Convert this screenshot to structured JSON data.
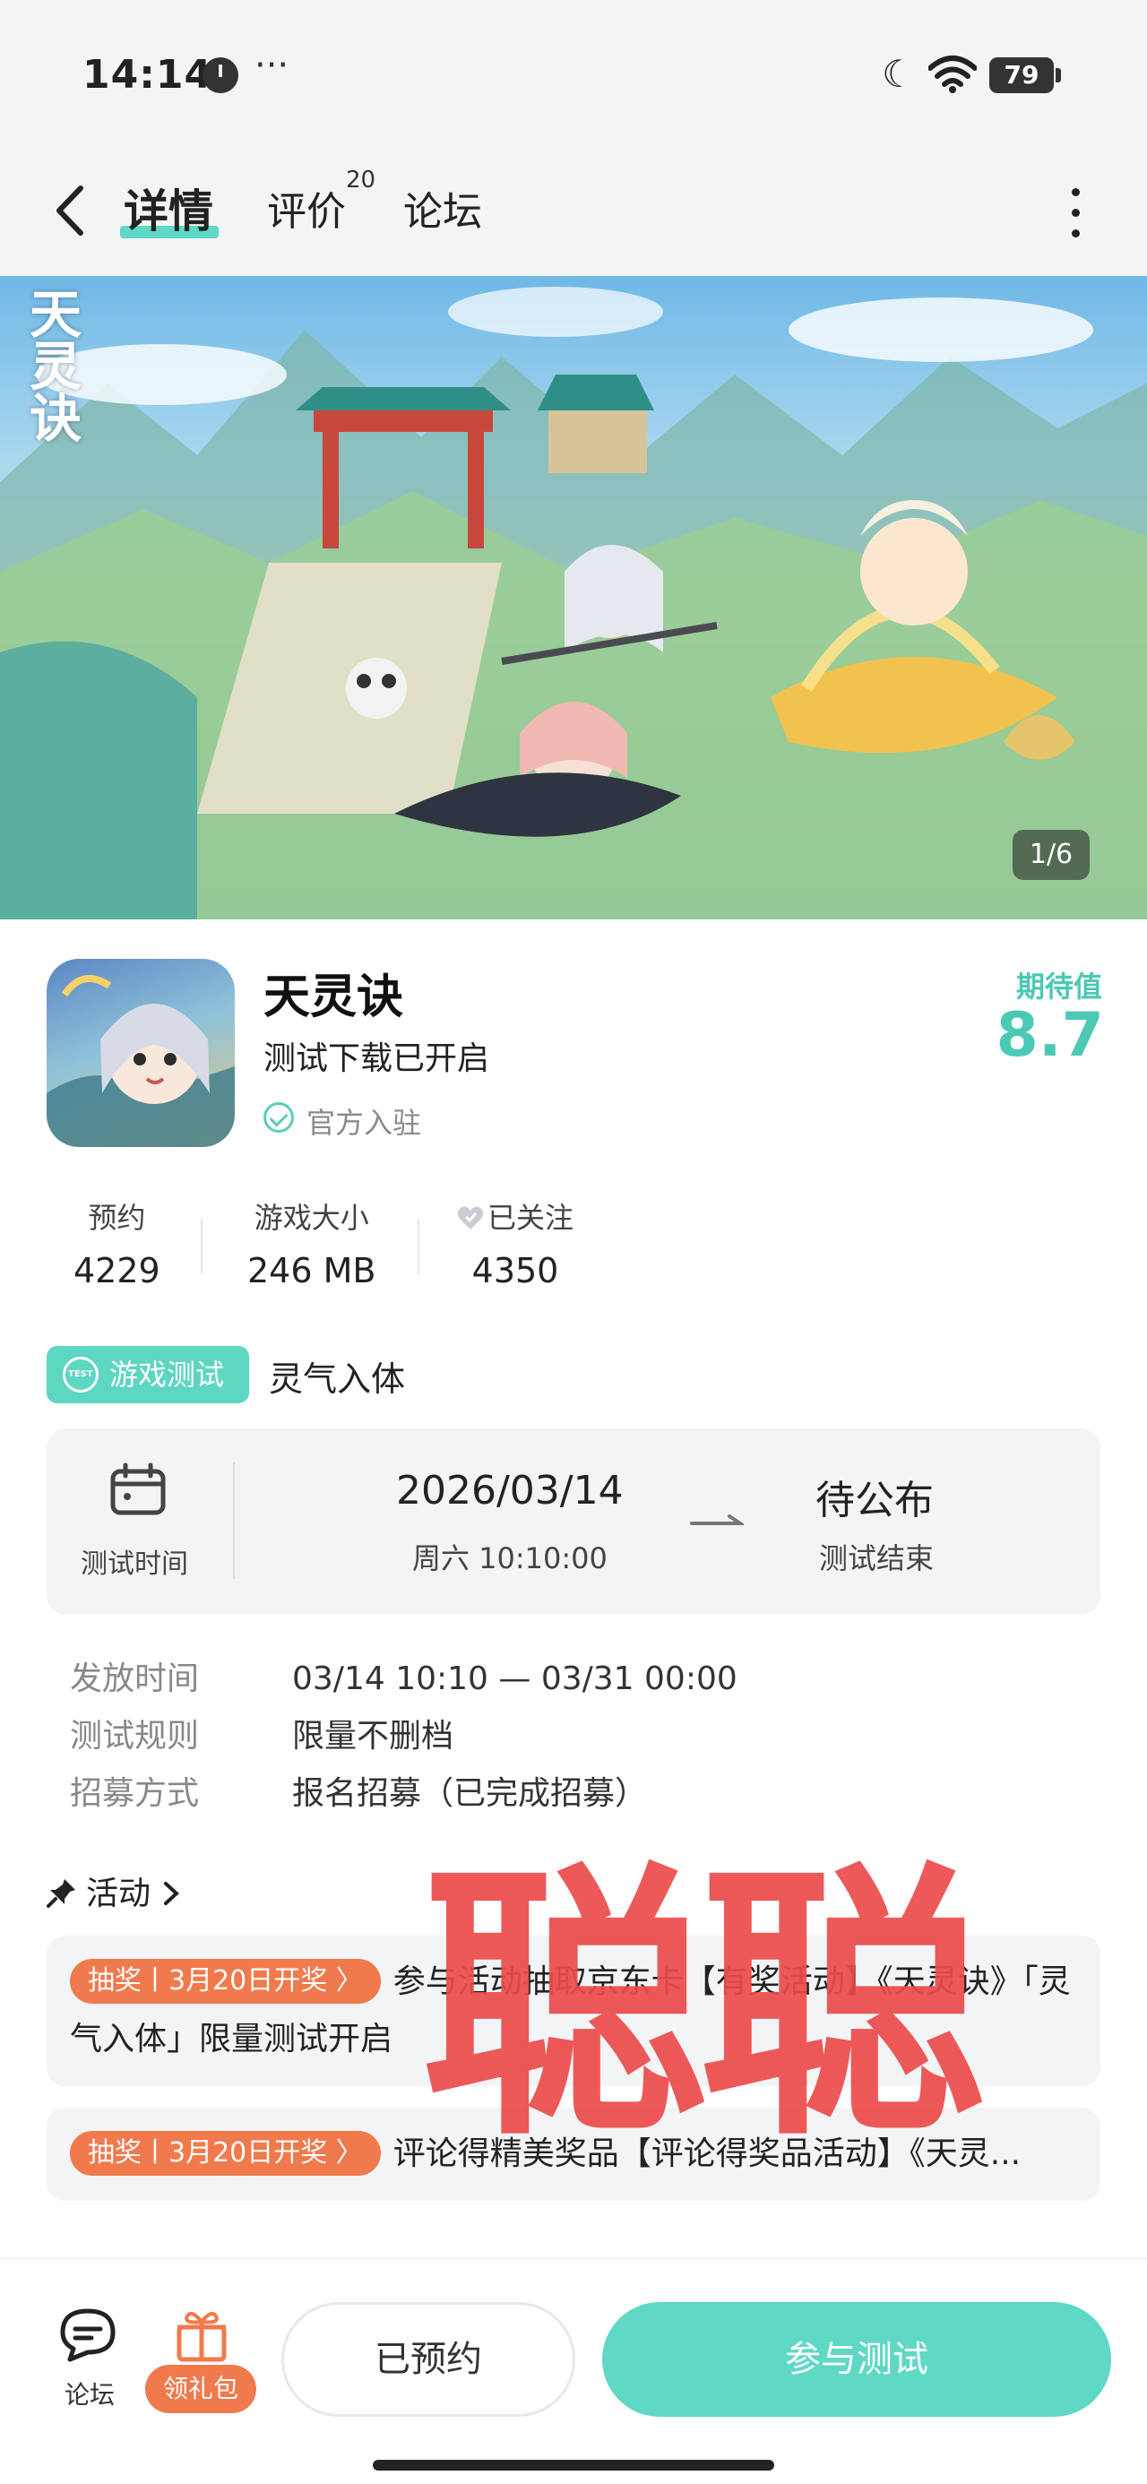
{
  "status_bar": {
    "time": "14:14",
    "more": "···",
    "battery": "79"
  },
  "nav": {
    "tab_detail": "详情",
    "tab_reviews": "评价",
    "reviews_count": "20",
    "tab_forum": "论坛"
  },
  "banner": {
    "logo_text": "天灵诀",
    "counter": "1/6"
  },
  "app": {
    "title": "天灵诀",
    "subtitle": "测试下载已开启",
    "official": "官方入驻",
    "expect_label": "期待值",
    "expect_value": "8.7"
  },
  "stats": [
    {
      "label": "预约",
      "value": "4229"
    },
    {
      "label": "游戏大小",
      "value": "246 MB"
    },
    {
      "label": "已关注",
      "value": "4350"
    }
  ],
  "test": {
    "tag": "游戏测试",
    "tag_icon_text": "TEST",
    "name": "灵气入体",
    "card_label": "测试时间",
    "start_date": "2026/03/14",
    "start_sub": "周六  10:10:00",
    "end_date": "待公布",
    "end_sub": "测试结束"
  },
  "info": [
    {
      "key": "发放时间",
      "value": "03/14 10:10 — 03/31 00:00"
    },
    {
      "key": "测试规则",
      "value": "限量不删档"
    },
    {
      "key": "招募方式",
      "value": "报名招募（已完成招募）"
    }
  ],
  "activities": {
    "heading": "活动",
    "items": [
      {
        "badge": "抽奖丨3月20日开奖 〉",
        "text": "参与活动抽取京东卡【有奖活动】《天灵诀》「灵气入体」限量测试开启"
      },
      {
        "badge": "抽奖丨3月20日开奖 〉",
        "text": "评论得精美奖品【评论得奖品活动】《天灵..."
      }
    ]
  },
  "watermark": "聪聪",
  "bottom": {
    "forum": "论坛",
    "gift": "领礼包",
    "reserved": "已预约",
    "join": "参与测试"
  },
  "colors": {
    "accent": "#5fd8c5",
    "accent_text": "#4cc9b4",
    "orange": "#f07a4c",
    "watermark": "#ec4b4b"
  }
}
